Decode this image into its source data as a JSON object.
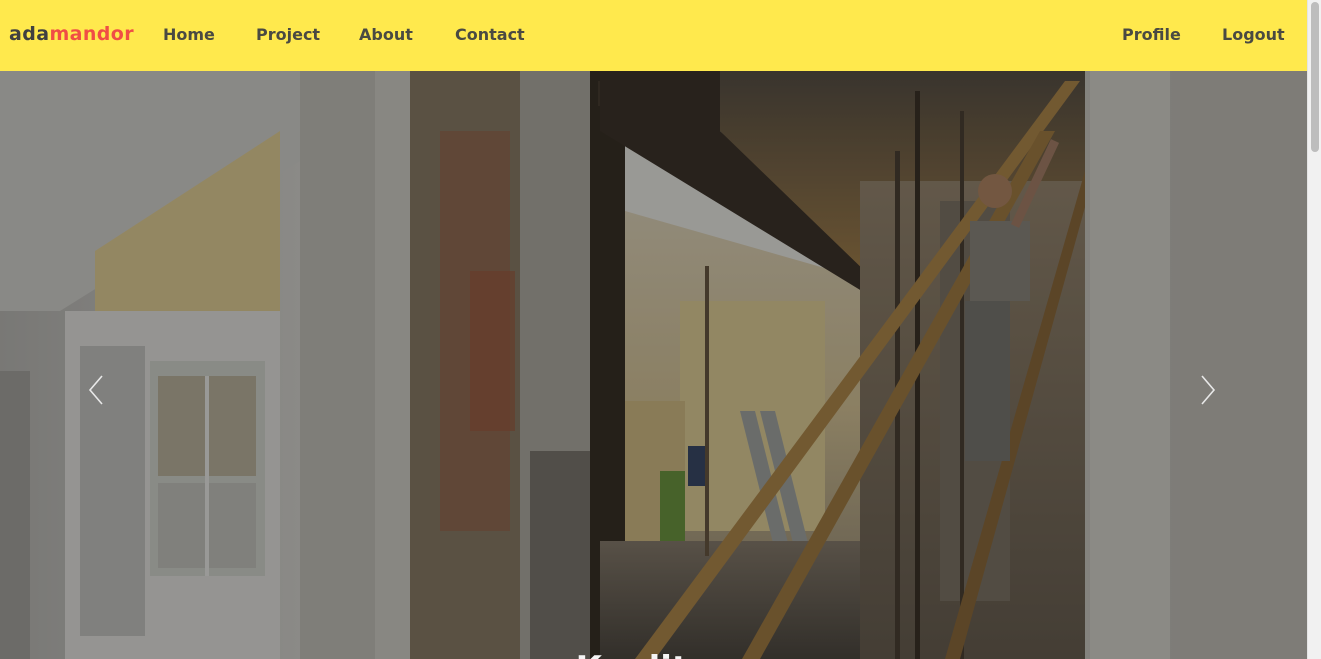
{
  "brand": {
    "part1": "ada",
    "part2": "mandor"
  },
  "nav": {
    "home": "Home",
    "project": "Project",
    "about": "About",
    "contact": "Contact",
    "profile": "Profile",
    "logout": "Logout"
  },
  "carousel": {
    "image": "construction-site-renovation-photo",
    "prev_icon": "chevron-left-icon",
    "next_icon": "chevron-right-icon",
    "caption": "Kualitas"
  },
  "colors": {
    "navbar_bg": "#ffe94d",
    "brand_accent": "#f04e45",
    "nav_text": "#4a4a42"
  }
}
